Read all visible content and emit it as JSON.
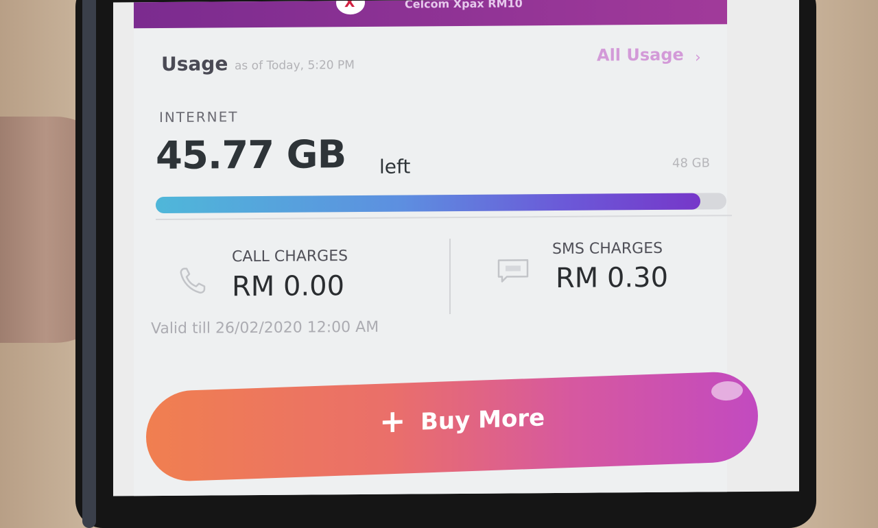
{
  "banner": {
    "title": "Celcom Xpax RM10"
  },
  "usage": {
    "title": "Usage",
    "timestamp": "as of Today, 5:20 PM",
    "all_usage_link": "All Usage",
    "chevron": "›"
  },
  "internet": {
    "label": "INTERNET",
    "remaining": "45.77 GB",
    "remaining_suffix": "left",
    "total": "48 GB",
    "progress_fraction": 0.954
  },
  "call": {
    "label": "CALL CHARGES",
    "value": "RM 0.00",
    "icon": "phone-icon"
  },
  "sms": {
    "label": "SMS CHARGES",
    "value": "RM 0.30",
    "icon": "sms-icon"
  },
  "validity": {
    "text": "Valid till 26/02/2020 12:00 AM"
  },
  "buy_more": {
    "plus": "+",
    "label": "Buy More"
  },
  "colors": {
    "accent": "#d39ad8",
    "banner": "#8a2f95",
    "button_start": "#f07f50",
    "button_end": "#c24ac0",
    "progress_start": "#4fb7d9",
    "progress_end": "#7637c9"
  }
}
